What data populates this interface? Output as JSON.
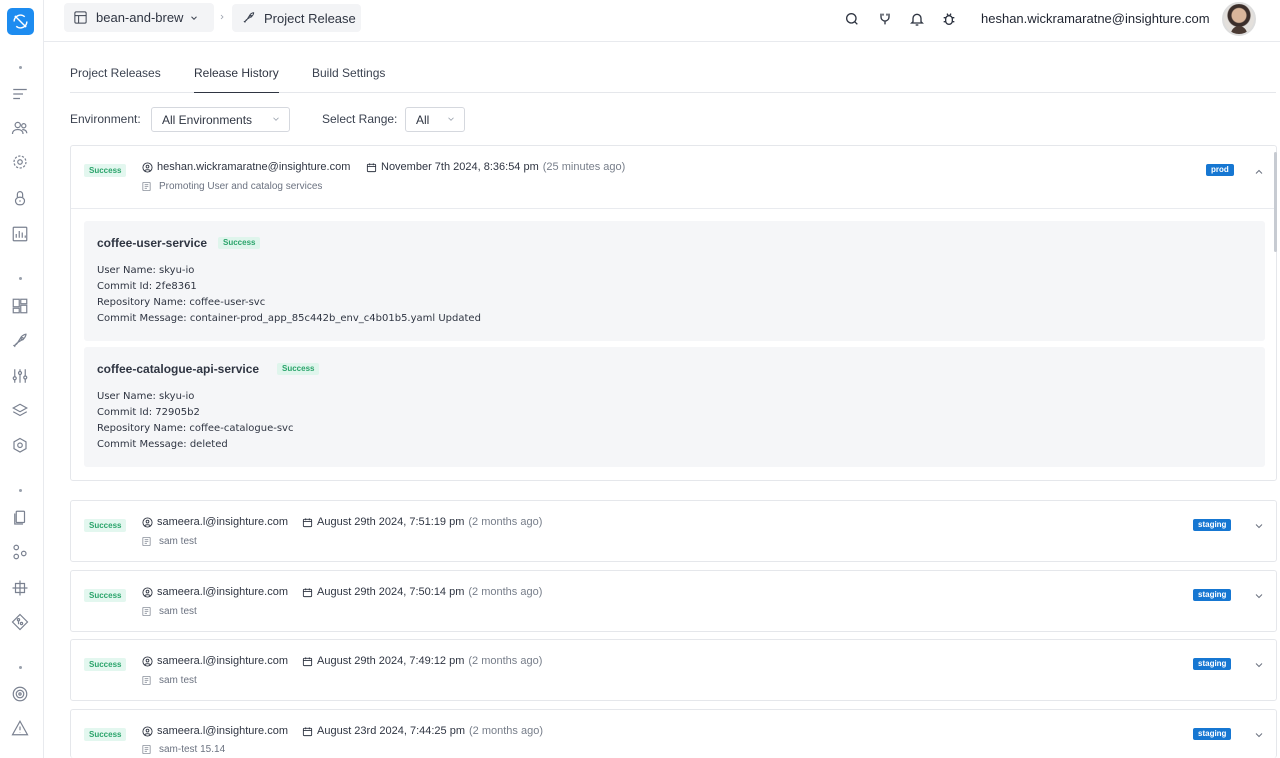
{
  "header": {
    "project_name": "bean-and-brew",
    "page_title": "Project Release",
    "user_email": "heshan.wickramaratne@insighture.com"
  },
  "tabs": [
    {
      "label": "Project Releases",
      "active": false
    },
    {
      "label": "Release History",
      "active": true
    },
    {
      "label": "Build Settings",
      "active": false
    }
  ],
  "filters": {
    "environment_label": "Environment:",
    "environment_value": "All Environments",
    "range_label": "Select Range:",
    "range_value": "All"
  },
  "releases": [
    {
      "status": "Success",
      "user": "heshan.wickramaratne@insighture.com",
      "date": "November 7th 2024, 8:36:54 pm",
      "ago": "(25 minutes ago)",
      "message": "Promoting User and catalog services",
      "env": "prod",
      "expanded": true,
      "services": [
        {
          "name": "coffee-user-service",
          "status": "Success",
          "user_name": "User Name: skyu-io",
          "commit_id": "Commit Id: 2fe8361",
          "repo": "Repository Name: coffee-user-svc",
          "commit_message": "Commit Message: container-prod_app_85c442b_env_c4b01b5.yaml Updated"
        },
        {
          "name": "coffee-catalogue-api-service",
          "status": "Success",
          "user_name": "User Name: skyu-io",
          "commit_id": "Commit Id: 72905b2",
          "repo": "Repository Name: coffee-catalogue-svc",
          "commit_message": "Commit Message: deleted"
        }
      ]
    },
    {
      "status": "Success",
      "user": "sameera.l@insighture.com",
      "date": "August 29th 2024, 7:51:19 pm",
      "ago": "(2 months ago)",
      "message": "sam test",
      "env": "staging",
      "expanded": false
    },
    {
      "status": "Success",
      "user": "sameera.l@insighture.com",
      "date": "August 29th 2024, 7:50:14 pm",
      "ago": "(2 months ago)",
      "message": "sam test",
      "env": "staging",
      "expanded": false
    },
    {
      "status": "Success",
      "user": "sameera.l@insighture.com",
      "date": "August 29th 2024, 7:49:12 pm",
      "ago": "(2 months ago)",
      "message": "sam test",
      "env": "staging",
      "expanded": false
    },
    {
      "status": "Success",
      "user": "sameera.l@insighture.com",
      "date": "August 23rd 2024, 7:44:25 pm",
      "ago": "(2 months ago)",
      "message": "sam-test 15.14",
      "env": "staging",
      "expanded": false
    }
  ],
  "colors": {
    "accent": "#1d8cf0",
    "env_badge": "#1677d2",
    "success_bg": "#e3f7ef",
    "success_text": "#2ba46b"
  },
  "icons": {
    "sidebar": [
      "logo-icon",
      "menu-lines-icon",
      "users-icon",
      "settings-icon",
      "lock-icon",
      "chart-icon",
      "dashboard-icon",
      "rocket-icon",
      "sliders-icon",
      "layers-icon",
      "helm-icon",
      "documents-icon",
      "nodes-icon",
      "network-icon",
      "git-icon",
      "target-icon",
      "warning-icon"
    ],
    "topbar": [
      "search-icon",
      "plugin-icon",
      "bell-icon",
      "bug-icon"
    ]
  }
}
